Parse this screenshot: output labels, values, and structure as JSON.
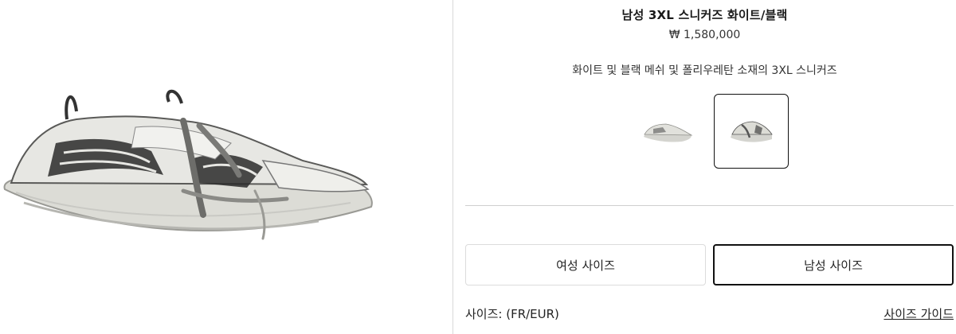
{
  "product": {
    "title": "남성 3XL 스니커즈 화이트/블랙",
    "price": "₩ 1,580,000",
    "description": "화이트 및 블랙 메쉬 및 폴리우레탄 소재의 3XL 스니커즈"
  },
  "gallery": {
    "hero_image": "sneaker-side-view-image",
    "thumbnails": [
      {
        "name": "thumbnail-sneaker-side",
        "selected": false
      },
      {
        "name": "thumbnail-sneaker-angle",
        "selected": true
      }
    ]
  },
  "size_selector": {
    "women_label": "여성 사이즈",
    "men_label": "남성 사이즈",
    "selected": "men",
    "size_label": "사이즈: (FR/EUR)",
    "size_guide_label": "사이즈 가이드"
  },
  "colors": {
    "border_selected": "#111111",
    "border_default": "#dcdcdc",
    "divider": "#cfcfcf"
  }
}
